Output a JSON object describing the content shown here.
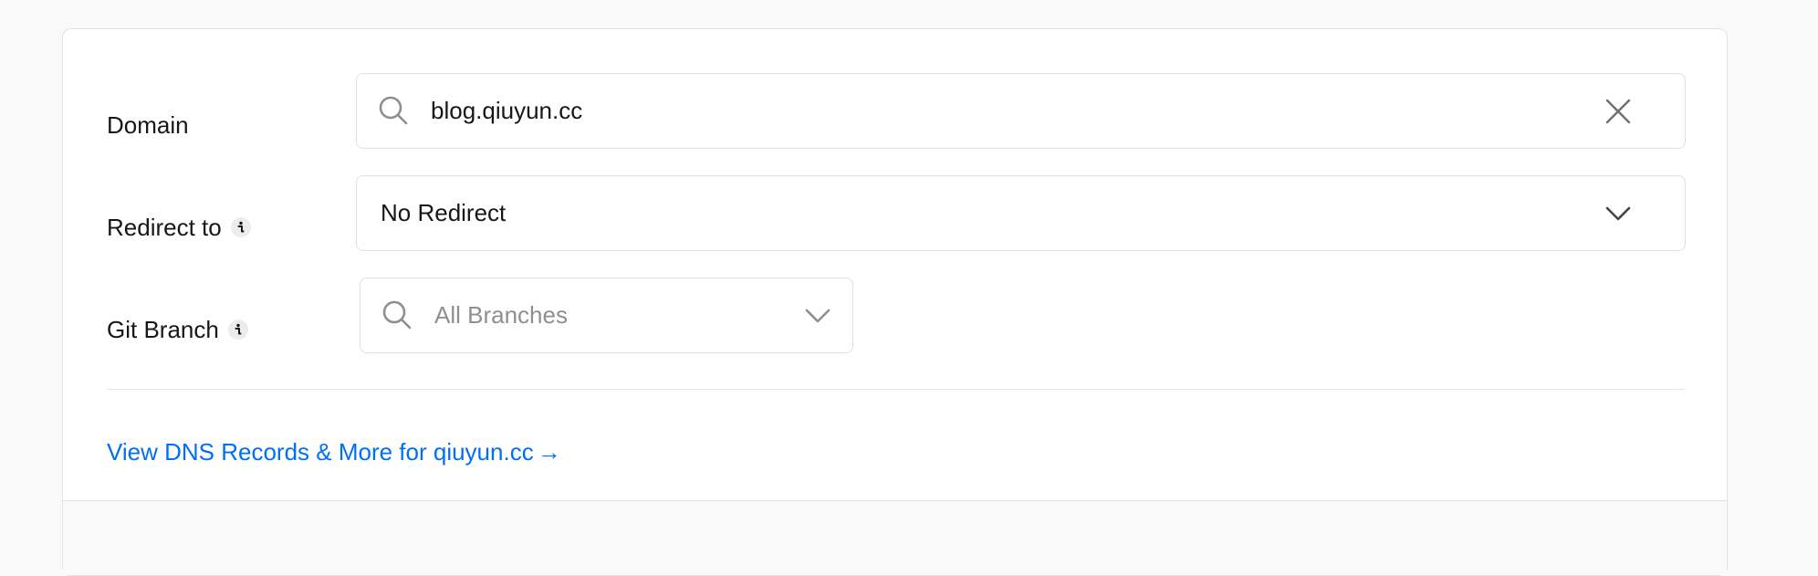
{
  "domain": {
    "label": "Domain",
    "value": "blog.qiuyun.cc"
  },
  "redirect": {
    "label": "Redirect to",
    "selected": "No Redirect"
  },
  "git_branch": {
    "label": "Git Branch",
    "placeholder": "All Branches"
  },
  "dns_link": {
    "text": "View DNS Records & More for qiuyun.cc",
    "arrow": "→"
  },
  "icons": {
    "search": "search-icon",
    "clear": "close-icon",
    "dropdown": "chevron-down-icon",
    "info": "info-icon",
    "link_arrow": "arrow-right-icon"
  },
  "colors": {
    "link": "#0070f3",
    "text": "#171717",
    "placeholder": "#8f8f8f",
    "border": "#e0e0e0"
  }
}
